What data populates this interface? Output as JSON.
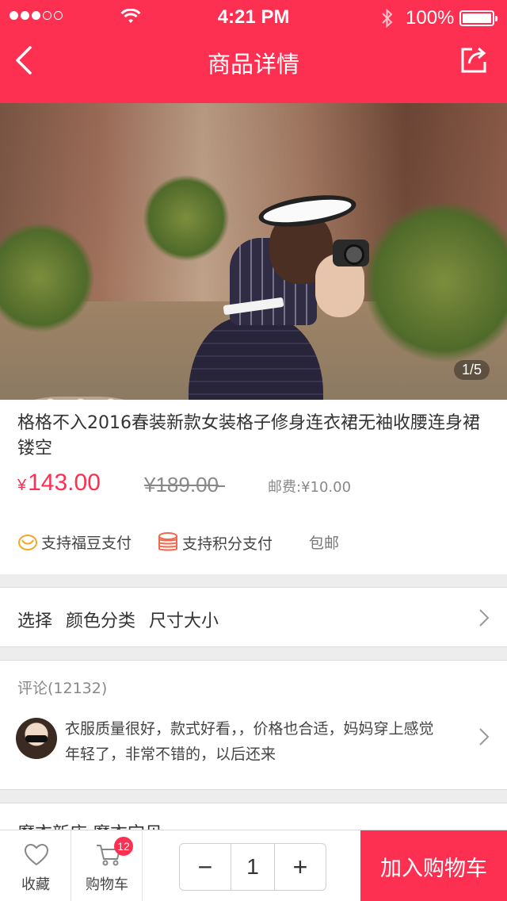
{
  "status_bar": {
    "time": "4:21 PM",
    "battery": "100%"
  },
  "header": {
    "title": "商品详情"
  },
  "gallery": {
    "page_indicator": "1/5"
  },
  "product": {
    "title": "格格不入2016春装新款女装格子修身连衣裙无袖收腰连身裙镂空",
    "currency": "¥",
    "price": "143.00",
    "original_price": "¥189.00",
    "shipping": "邮费:¥10.00"
  },
  "payment": {
    "fudou": "支持福豆支付",
    "points": "支持积分支付",
    "free_shipping": "包邮"
  },
  "selection": {
    "label": "选择  颜色分类  尺寸大小"
  },
  "comments": {
    "header": "评论(12132)",
    "text": "衣服质量很好，款式好看，，价格也合适，妈妈穿上感觉年轻了，非常不错的，以后还来"
  },
  "shop": {
    "name": "魔衣新店 魔衣宝贝"
  },
  "bottom_bar": {
    "favorite_label": "收藏",
    "cart_label": "购物车",
    "cart_badge": "12",
    "quantity": "1",
    "minus": "−",
    "plus": "+",
    "add_to_cart": "加入购物车"
  },
  "colors": {
    "accent": "#fe3052",
    "coin": "#f5a623"
  },
  "icons": [
    "back-arrow-icon",
    "share-icon",
    "coin-icon",
    "coins-stack-icon",
    "chevron-right-icon",
    "heart-icon",
    "cart-icon",
    "wifi-icon",
    "bluetooth-icon",
    "battery-icon",
    "signal-icon"
  ]
}
